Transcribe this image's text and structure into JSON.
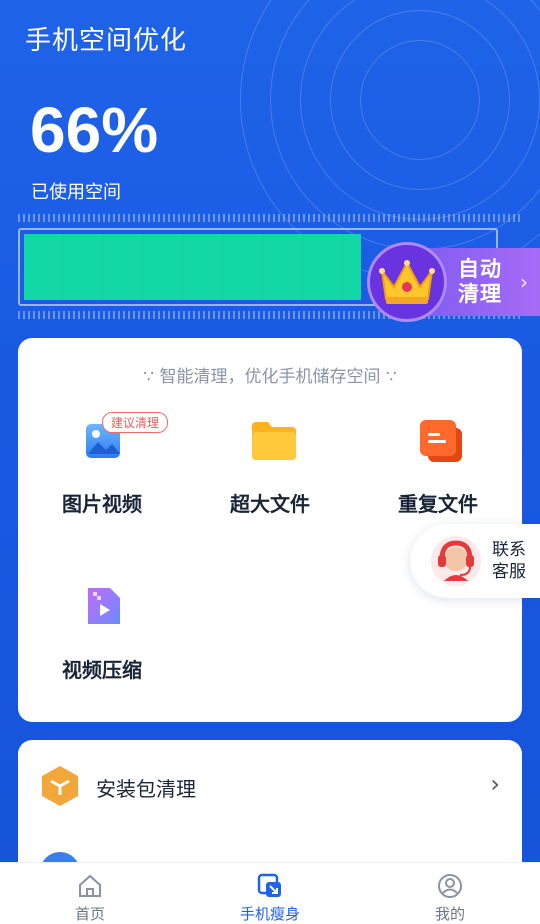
{
  "header": {
    "title": "手机空间优化"
  },
  "storage": {
    "percent_text": "66%",
    "percent_value": 0.66,
    "label": "已使用空间"
  },
  "auto_clean": {
    "label": "自动清理",
    "line1": "自动",
    "line2": "清理",
    "icon": "crown-icon",
    "chevron": "›"
  },
  "tools_card": {
    "subtitle": "∵ 智能清理，优化手机储存空间 ∵",
    "items": [
      {
        "label": "图片视频",
        "icon": "image-icon",
        "badge": "建议清理"
      },
      {
        "label": "超大文件",
        "icon": "folder-icon"
      },
      {
        "label": "重复文件",
        "icon": "duplicate-file-icon"
      },
      {
        "label": "视频压缩",
        "icon": "video-compress-icon"
      }
    ]
  },
  "service": {
    "line1": "联系",
    "line2": "客服",
    "icon": "customer-service-icon"
  },
  "list_card": {
    "items": [
      {
        "label": "安装包清理",
        "icon": "package-icon",
        "chevron": "›"
      }
    ]
  },
  "tabbar": {
    "tabs": [
      {
        "label": "首页",
        "icon": "home-icon",
        "active": false
      },
      {
        "label": "手机瘦身",
        "icon": "phone-slim-icon",
        "active": true
      },
      {
        "label": "我的",
        "icon": "profile-icon",
        "active": false
      }
    ]
  },
  "colors": {
    "primary": "#1f63e8",
    "bar_fill": "#12d8a5",
    "accent_purple": "#7a58f0",
    "badge_red": "#f05a5a"
  }
}
